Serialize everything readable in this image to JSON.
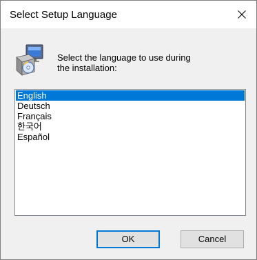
{
  "window": {
    "title": "Select Setup Language"
  },
  "prompt": {
    "line1": "Select the language to use during",
    "line2": "the installation:"
  },
  "languages": [
    {
      "label": "English",
      "selected": true
    },
    {
      "label": "Deutsch",
      "selected": false
    },
    {
      "label": "Français",
      "selected": false
    },
    {
      "label": "한국어",
      "selected": false
    },
    {
      "label": "Español",
      "selected": false
    }
  ],
  "buttons": {
    "ok": "OK",
    "cancel": "Cancel"
  },
  "icons": {
    "close": "close-icon",
    "setup": "setup-installer-icon"
  },
  "colors": {
    "selection": "#0078d7",
    "dialog_bg": "#f0f0f0"
  }
}
